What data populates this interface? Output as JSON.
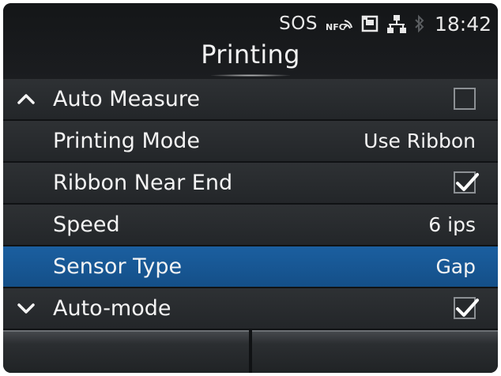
{
  "status_bar": {
    "sos_label": "SOS",
    "nfc_label": "NFC",
    "time": "18:42",
    "icons": [
      "nfc-signal-icon",
      "sd-card-icon",
      "network-icon",
      "bluetooth-icon"
    ]
  },
  "screen": {
    "title": "Printing"
  },
  "menu": {
    "items": [
      {
        "label": "Auto Measure",
        "control": "checkbox",
        "checked": false,
        "chevron": "up"
      },
      {
        "label": "Printing Mode",
        "value": "Use Ribbon"
      },
      {
        "label": "Ribbon Near End",
        "control": "checkbox",
        "checked": true
      },
      {
        "label": "Speed",
        "value": "6 ips"
      },
      {
        "label": "Sensor Type",
        "value": "Gap",
        "selected": true
      },
      {
        "label": "Auto-mode",
        "control": "checkbox",
        "checked": true,
        "chevron": "down"
      }
    ]
  },
  "softkeys": {
    "left_label": "",
    "right_label": ""
  },
  "colors": {
    "background": "#101214",
    "row": "#2e3134",
    "selected_row": "#1b5fa0",
    "text": "#f4f4f4"
  }
}
